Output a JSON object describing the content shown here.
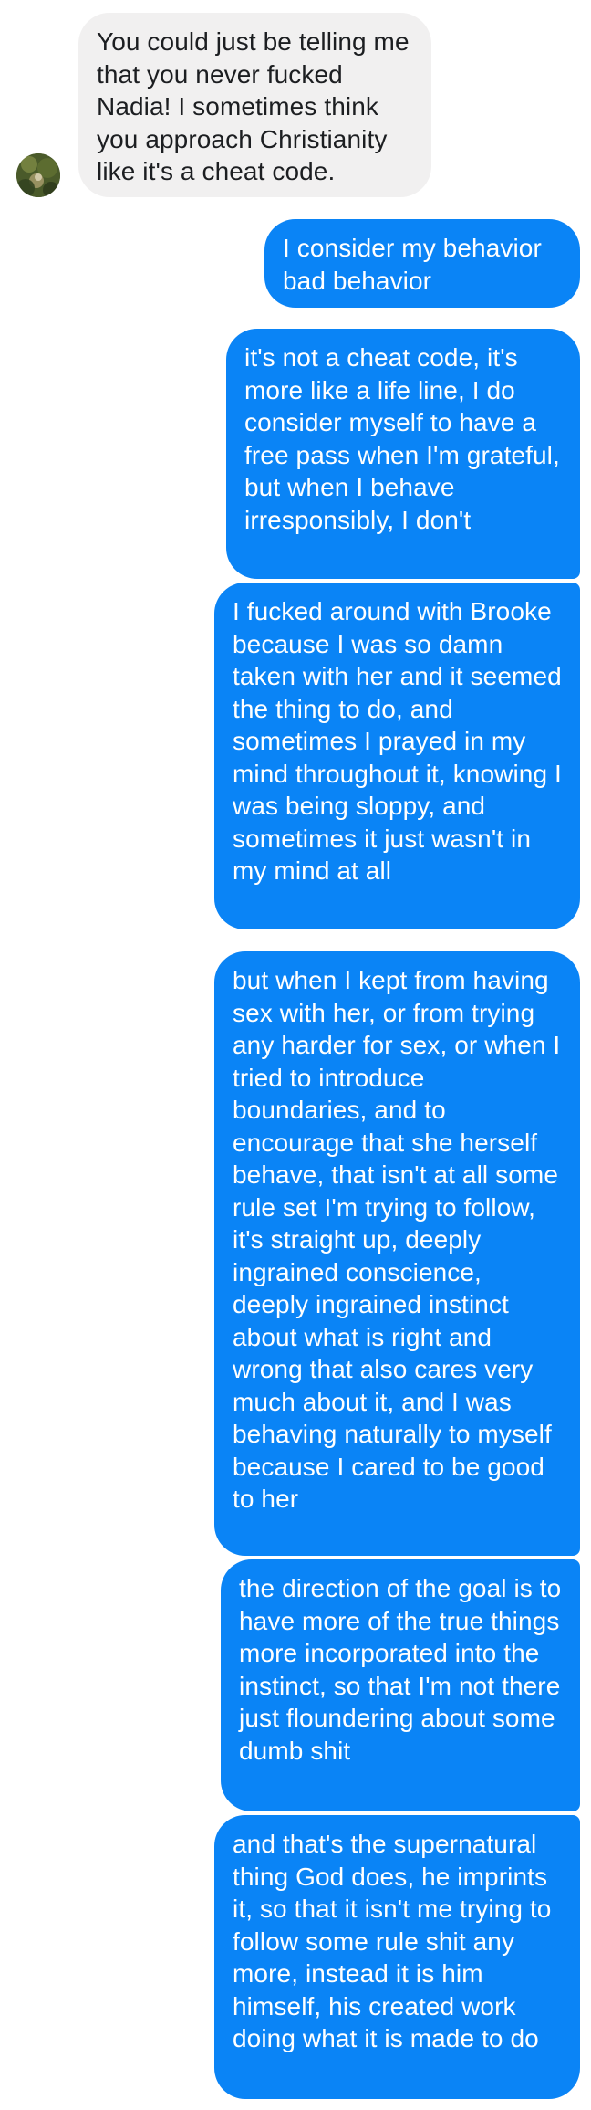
{
  "conversation": {
    "messages": [
      {
        "direction": "incoming",
        "text": "You could just be telling me that you never fucked Nadia! I sometimes think you approach Christianity like it's a cheat code."
      },
      {
        "direction": "outgoing",
        "text": "I consider my behavior bad behavior"
      },
      {
        "direction": "outgoing",
        "text": "it's not a cheat code, it's more like a life line, I do consider myself to have a free pass when I'm grateful, but when I behave irresponsibly, I don't"
      },
      {
        "direction": "outgoing",
        "text": "I fucked around with Brooke because I was so damn taken with her and it seemed the thing to do, and sometimes I prayed in my mind throughout it, knowing I was being sloppy, and sometimes it just wasn't in my mind at all"
      },
      {
        "direction": "outgoing",
        "text": "but when I kept from having sex with her, or from trying any harder for sex, or when I tried to introduce boundaries, and to encourage that she herself behave, that isn't at all some rule set I'm trying to follow, it's straight up, deeply ingrained conscience, deeply ingrained instinct about what is right and wrong that also cares very much about it, and I was behaving naturally to myself because I cared to be good to her"
      },
      {
        "direction": "outgoing",
        "text": "the direction of the goal is to have more of the true things more incorporated into the instinct, so that I'm not there just floundering about some dumb shit"
      },
      {
        "direction": "outgoing",
        "text": "and that's the supernatural thing God does, he imprints it, so that it isn't me trying to follow some rule shit any more, instead it is him himself, his created work doing what it is made to do"
      }
    ]
  },
  "colors": {
    "outgoing_bubble": "#0a84f6",
    "incoming_bubble": "#f1f0f0",
    "incoming_text": "#1c1e21",
    "outgoing_text": "#ffffff"
  },
  "icons": {
    "avatar": "contact-avatar-photo"
  }
}
